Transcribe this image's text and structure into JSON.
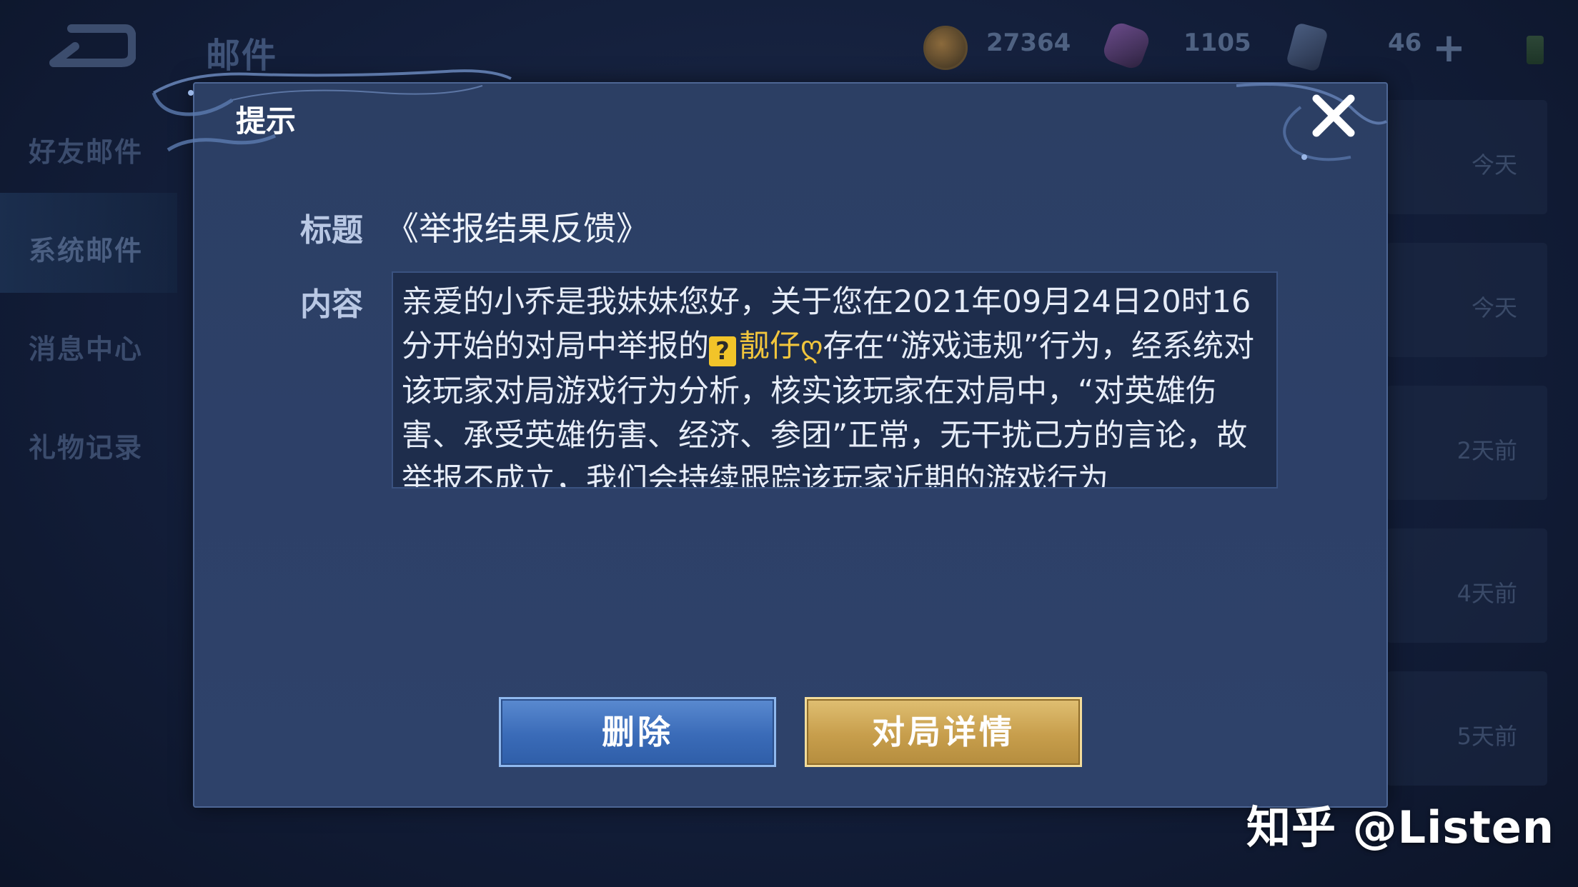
{
  "header": {
    "page_title": "邮件",
    "coins": "27364",
    "gems": "1105",
    "tickets": "46"
  },
  "sidebar": {
    "items": [
      {
        "label": "好友邮件"
      },
      {
        "label": "系统邮件"
      },
      {
        "label": "消息中心"
      },
      {
        "label": "礼物记录"
      }
    ]
  },
  "mail_list": {
    "times": [
      "今天",
      "今天",
      "2天前",
      "4天前",
      "5天前"
    ]
  },
  "dialog": {
    "title": "提示",
    "subject_label": "标题",
    "subject": "《举报结果反馈》",
    "content_label": "内容",
    "content_before": "亲爱的小乔是我妹妹您好，关于您在2021年09月24日20时16分开始的对局中举报的",
    "player_badge": "?",
    "player_name": "靓仔",
    "player_suffix_icon": "ღ",
    "content_after": "存在“游戏违规”行为，经系统对该玩家对局游戏行为分析，核实该玩家在对局中，“对英雄伤害、承受英雄伤害、经济、参团”正常，无干扰己方的言论，故举报不成立，我们会持续跟踪该玩家近期的游戏行为",
    "delete_label": "删除",
    "detail_label": "对局详情"
  },
  "watermark": "知乎 @Listen",
  "colors": {
    "dialog_bg": "#2d4068",
    "accent_gold": "#f1c53d",
    "button_blue": "#3a6bb8",
    "button_gold": "#c79e4c"
  },
  "icons": [
    "back-arrow-icon",
    "coin-icon",
    "gem-icon",
    "ticket-icon",
    "plus-icon",
    "wifi-icon",
    "close-icon",
    "question-icon",
    "heart-icon"
  ]
}
